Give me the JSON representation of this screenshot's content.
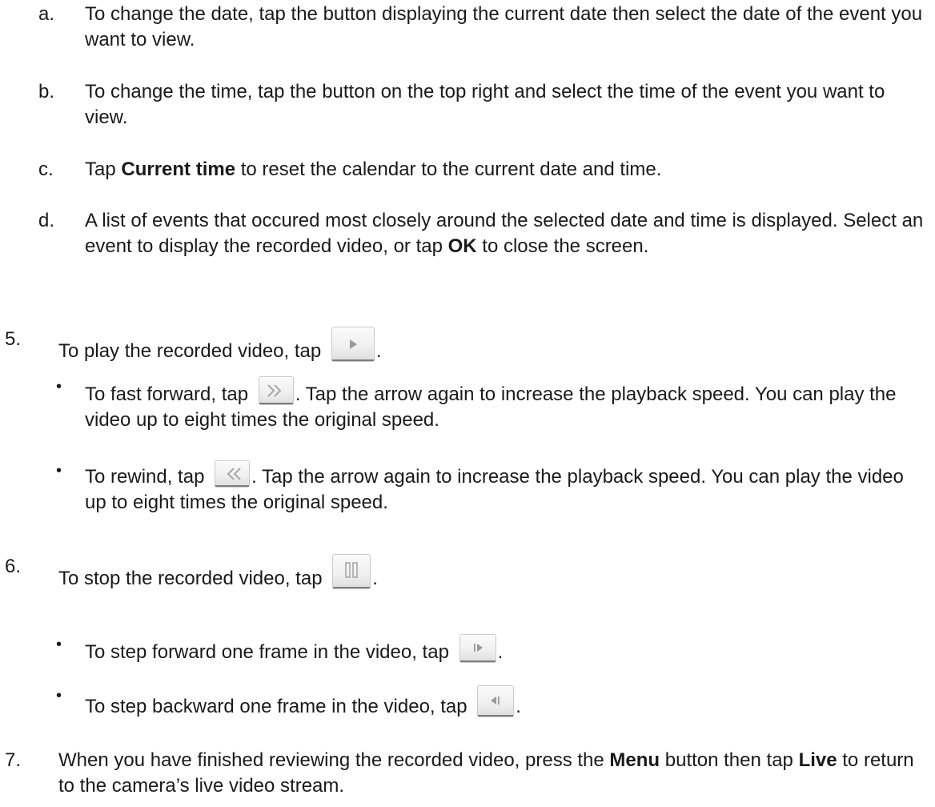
{
  "steps_abcd": [
    {
      "marker": "a.",
      "text": "To change the date, tap the button displaying the current date then select the date of the event you want to view."
    },
    {
      "marker": "b.",
      "text": "To change the time, tap the button on the top right and select the time of the event you want to view."
    },
    {
      "marker": "c.",
      "pre": "Tap ",
      "bold": "Current time",
      "post": " to reset the calendar to the current date and time."
    },
    {
      "marker": "d.",
      "pre": "A list of events that occured most closely around the selected date and time is displayed. Select an event to display the recorded video, or tap ",
      "bold": "OK",
      "post": " to close the screen."
    }
  ],
  "step5": {
    "marker": "5.",
    "pre": "To play the recorded video, tap ",
    "post": ".",
    "icon": "play-icon"
  },
  "step5_bullets": [
    {
      "marker": "•",
      "pre": "To fast forward, tap ",
      "post": ". Tap the arrow again to increase the playback speed. You can play the video up to eight times the original speed.",
      "icon": "fast-forward-icon"
    },
    {
      "marker": "•",
      "pre": "To rewind, tap ",
      "post": ". Tap the arrow again to increase the playback speed. You can play the video up to eight times the original speed.",
      "icon": "rewind-icon"
    }
  ],
  "step6": {
    "marker": "6.",
    "pre": "To stop the recorded video, tap ",
    "post": ".",
    "icon": "pause-icon"
  },
  "step6_bullets": [
    {
      "marker": "•",
      "pre": "To step forward one frame in the video, tap ",
      "post": ".",
      "icon": "step-forward-icon"
    },
    {
      "marker": "•",
      "pre": "To step backward one frame in the video, tap ",
      "post": ".",
      "icon": "step-backward-icon"
    }
  ],
  "step7": {
    "marker": "7.",
    "pre": "When you have finished reviewing the recorded video, press the ",
    "bold1": "Menu",
    "mid": " button then tap ",
    "bold2": "Live",
    "post": " to return to the camera’s live video stream."
  },
  "colors": {
    "text": "#1a1a1a",
    "icon_glyph": "#9a9a9a",
    "button_border": "#c9c9c9",
    "button_bg": "#f0f0f0"
  }
}
